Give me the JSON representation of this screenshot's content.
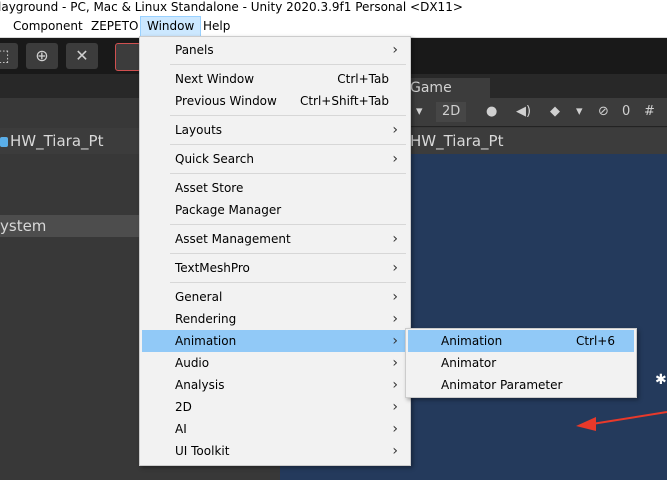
{
  "window": {
    "title": "layground - PC, Mac & Linux Standalone - Unity 2020.3.9f1 Personal <DX11>"
  },
  "menubar": {
    "items": [
      "Component",
      "ZEPETO",
      "Window",
      "Help"
    ],
    "active": "Window"
  },
  "editor": {
    "game_tab": "Game",
    "two_d_toggle": "2D",
    "hidden_count": "0",
    "hierarchy_root": "HW_Tiara_Pt",
    "scene_root": "HW_Tiara_Pt",
    "system_row": "ystem"
  },
  "window_menu": {
    "items": [
      {
        "label": "Panels",
        "shortcut": "",
        "submenu": true
      },
      {
        "label": "Next Window",
        "shortcut": "Ctrl+Tab",
        "submenu": false
      },
      {
        "label": "Previous Window",
        "shortcut": "Ctrl+Shift+Tab",
        "submenu": false
      },
      {
        "label": "Layouts",
        "shortcut": "",
        "submenu": true
      },
      {
        "label": "Quick Search",
        "shortcut": "",
        "submenu": true
      },
      {
        "label": "Asset Store",
        "shortcut": "",
        "submenu": false
      },
      {
        "label": "Package Manager",
        "shortcut": "",
        "submenu": false
      },
      {
        "label": "Asset Management",
        "shortcut": "",
        "submenu": true
      },
      {
        "label": "TextMeshPro",
        "shortcut": "",
        "submenu": true
      },
      {
        "label": "General",
        "shortcut": "",
        "submenu": true
      },
      {
        "label": "Rendering",
        "shortcut": "",
        "submenu": true
      },
      {
        "label": "Animation",
        "shortcut": "",
        "submenu": true,
        "highlighted": true
      },
      {
        "label": "Audio",
        "shortcut": "",
        "submenu": true
      },
      {
        "label": "Analysis",
        "shortcut": "",
        "submenu": true
      },
      {
        "label": "2D",
        "shortcut": "",
        "submenu": true
      },
      {
        "label": "AI",
        "shortcut": "",
        "submenu": true
      },
      {
        "label": "UI Toolkit",
        "shortcut": "",
        "submenu": true
      }
    ]
  },
  "animation_submenu": {
    "items": [
      {
        "label": "Animation",
        "shortcut": "Ctrl+6",
        "highlighted": true
      },
      {
        "label": "Animator",
        "shortcut": ""
      },
      {
        "label": "Animator Parameter",
        "shortcut": ""
      }
    ]
  },
  "colors": {
    "highlight": "#91c9f7",
    "menu_bg": "#f2f2f2",
    "viewport": "#243a5c",
    "annotation_arrow": "#e8392a"
  }
}
